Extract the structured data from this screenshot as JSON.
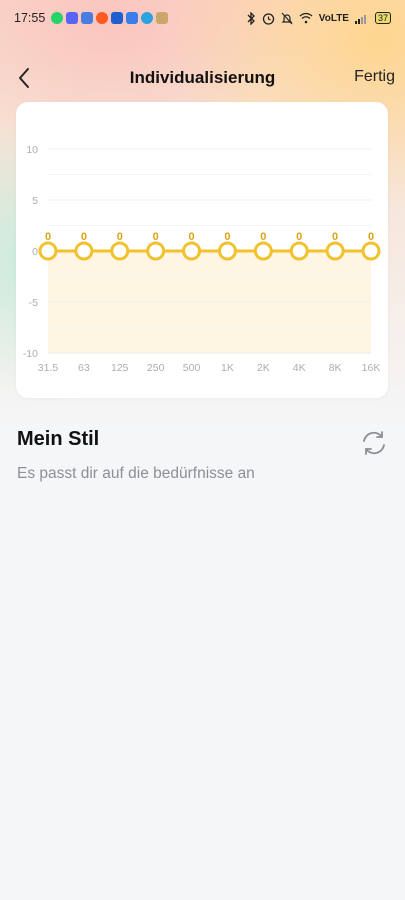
{
  "status_bar": {
    "time": "17:55",
    "network_label": "VoLTE",
    "battery_level": "37",
    "notification_icons": [
      "whatsapp-icon",
      "discord-icon",
      "chat-icon",
      "reddit-icon",
      "messages-icon",
      "mail-icon",
      "telegram-icon",
      "app-icon"
    ],
    "system_icons": [
      "bluetooth-icon",
      "alarm-icon",
      "mute-icon",
      "wifi-icon",
      "signal-icon"
    ]
  },
  "header": {
    "title": "Individualisierung",
    "done_label": "Fertig",
    "back_icon": "chevron-left-icon"
  },
  "chart_data": {
    "type": "line",
    "categories": [
      "31.5",
      "63",
      "125",
      "250",
      "500",
      "1K",
      "2K",
      "4K",
      "8K",
      "16K"
    ],
    "values": [
      0,
      0,
      0,
      0,
      0,
      0,
      0,
      0,
      0,
      0
    ],
    "data_labels": [
      "0",
      "0",
      "0",
      "0",
      "0",
      "0",
      "0",
      "0",
      "0",
      "0"
    ],
    "y_ticks": [
      "10",
      "5",
      "0",
      "-5",
      "-10"
    ],
    "ylim": [
      -10,
      10
    ],
    "grid": true,
    "colors": {
      "line": "#f2c12e",
      "fill": "#fef6e2",
      "grid": "#eeeeee",
      "tick": "#a9adb3"
    }
  },
  "style": {
    "title": "Mein Stil",
    "subtitle": "Es passt dir auf die bedürfnisse an",
    "reset_icon": "refresh-icon"
  }
}
